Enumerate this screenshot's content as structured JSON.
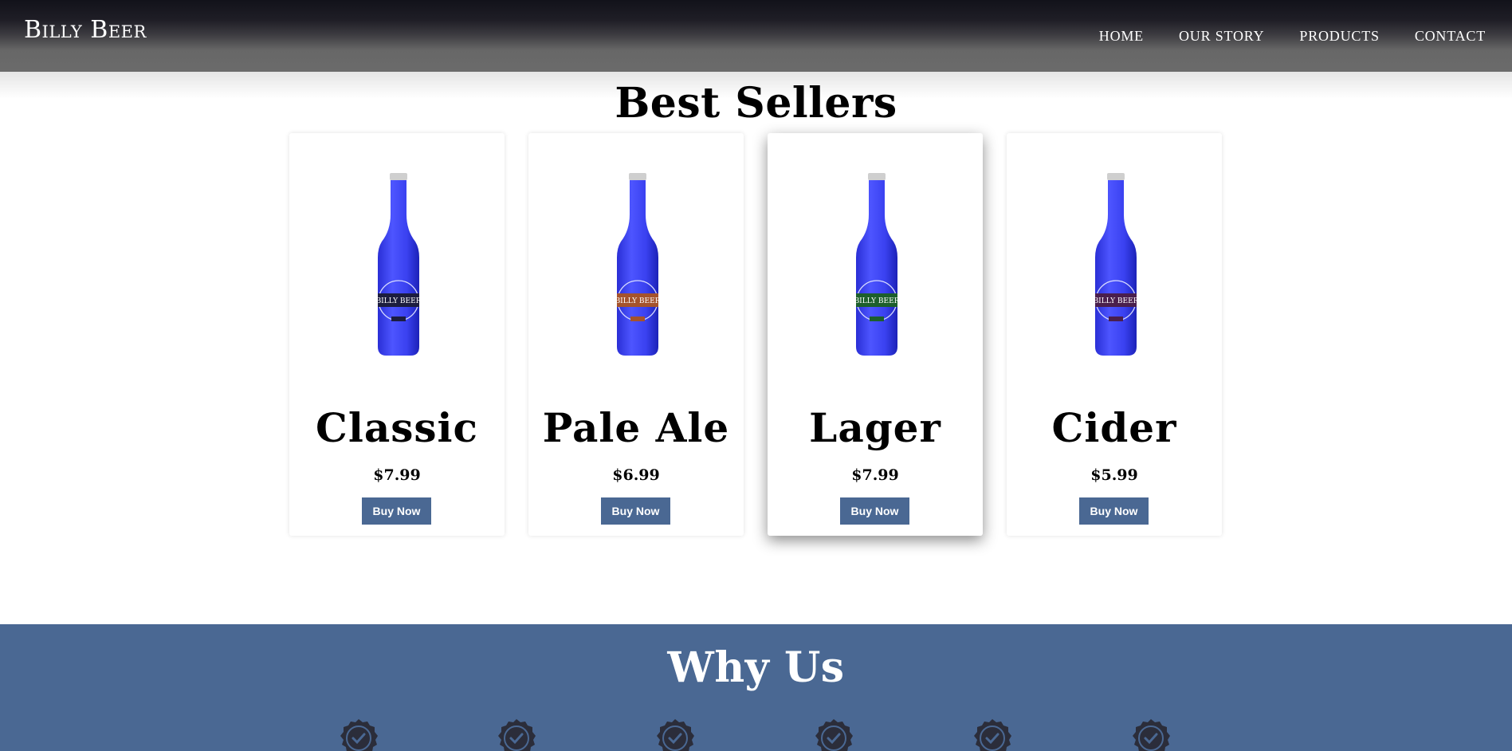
{
  "header": {
    "logo_text": "Billy Beer",
    "nav": [
      "HOME",
      "OUR STORY",
      "PRODUCTS",
      "CONTACT"
    ]
  },
  "best_sellers": {
    "title": "Best Sellers",
    "products": [
      {
        "name": "Classic",
        "price": "$7.99",
        "button": "Buy Now",
        "label_color": "#1c1d3f"
      },
      {
        "name": "Pale Ale",
        "price": "$6.99",
        "button": "Buy Now",
        "label_color": "#a5532c"
      },
      {
        "name": "Lager",
        "price": "$7.99",
        "button": "Buy Now",
        "label_color": "#1d5f2c"
      },
      {
        "name": "Cider",
        "price": "$5.99",
        "button": "Buy Now",
        "label_color": "#4a1f4d"
      }
    ]
  },
  "why_us": {
    "title": "Why Us",
    "badges": [
      "check-badge-icon",
      "check-badge-icon",
      "check-badge-icon",
      "check-badge-icon",
      "check-badge-icon",
      "check-badge-icon"
    ]
  },
  "colors": {
    "accent": "#4a6893",
    "badge_dark": "#2b2d3a"
  }
}
